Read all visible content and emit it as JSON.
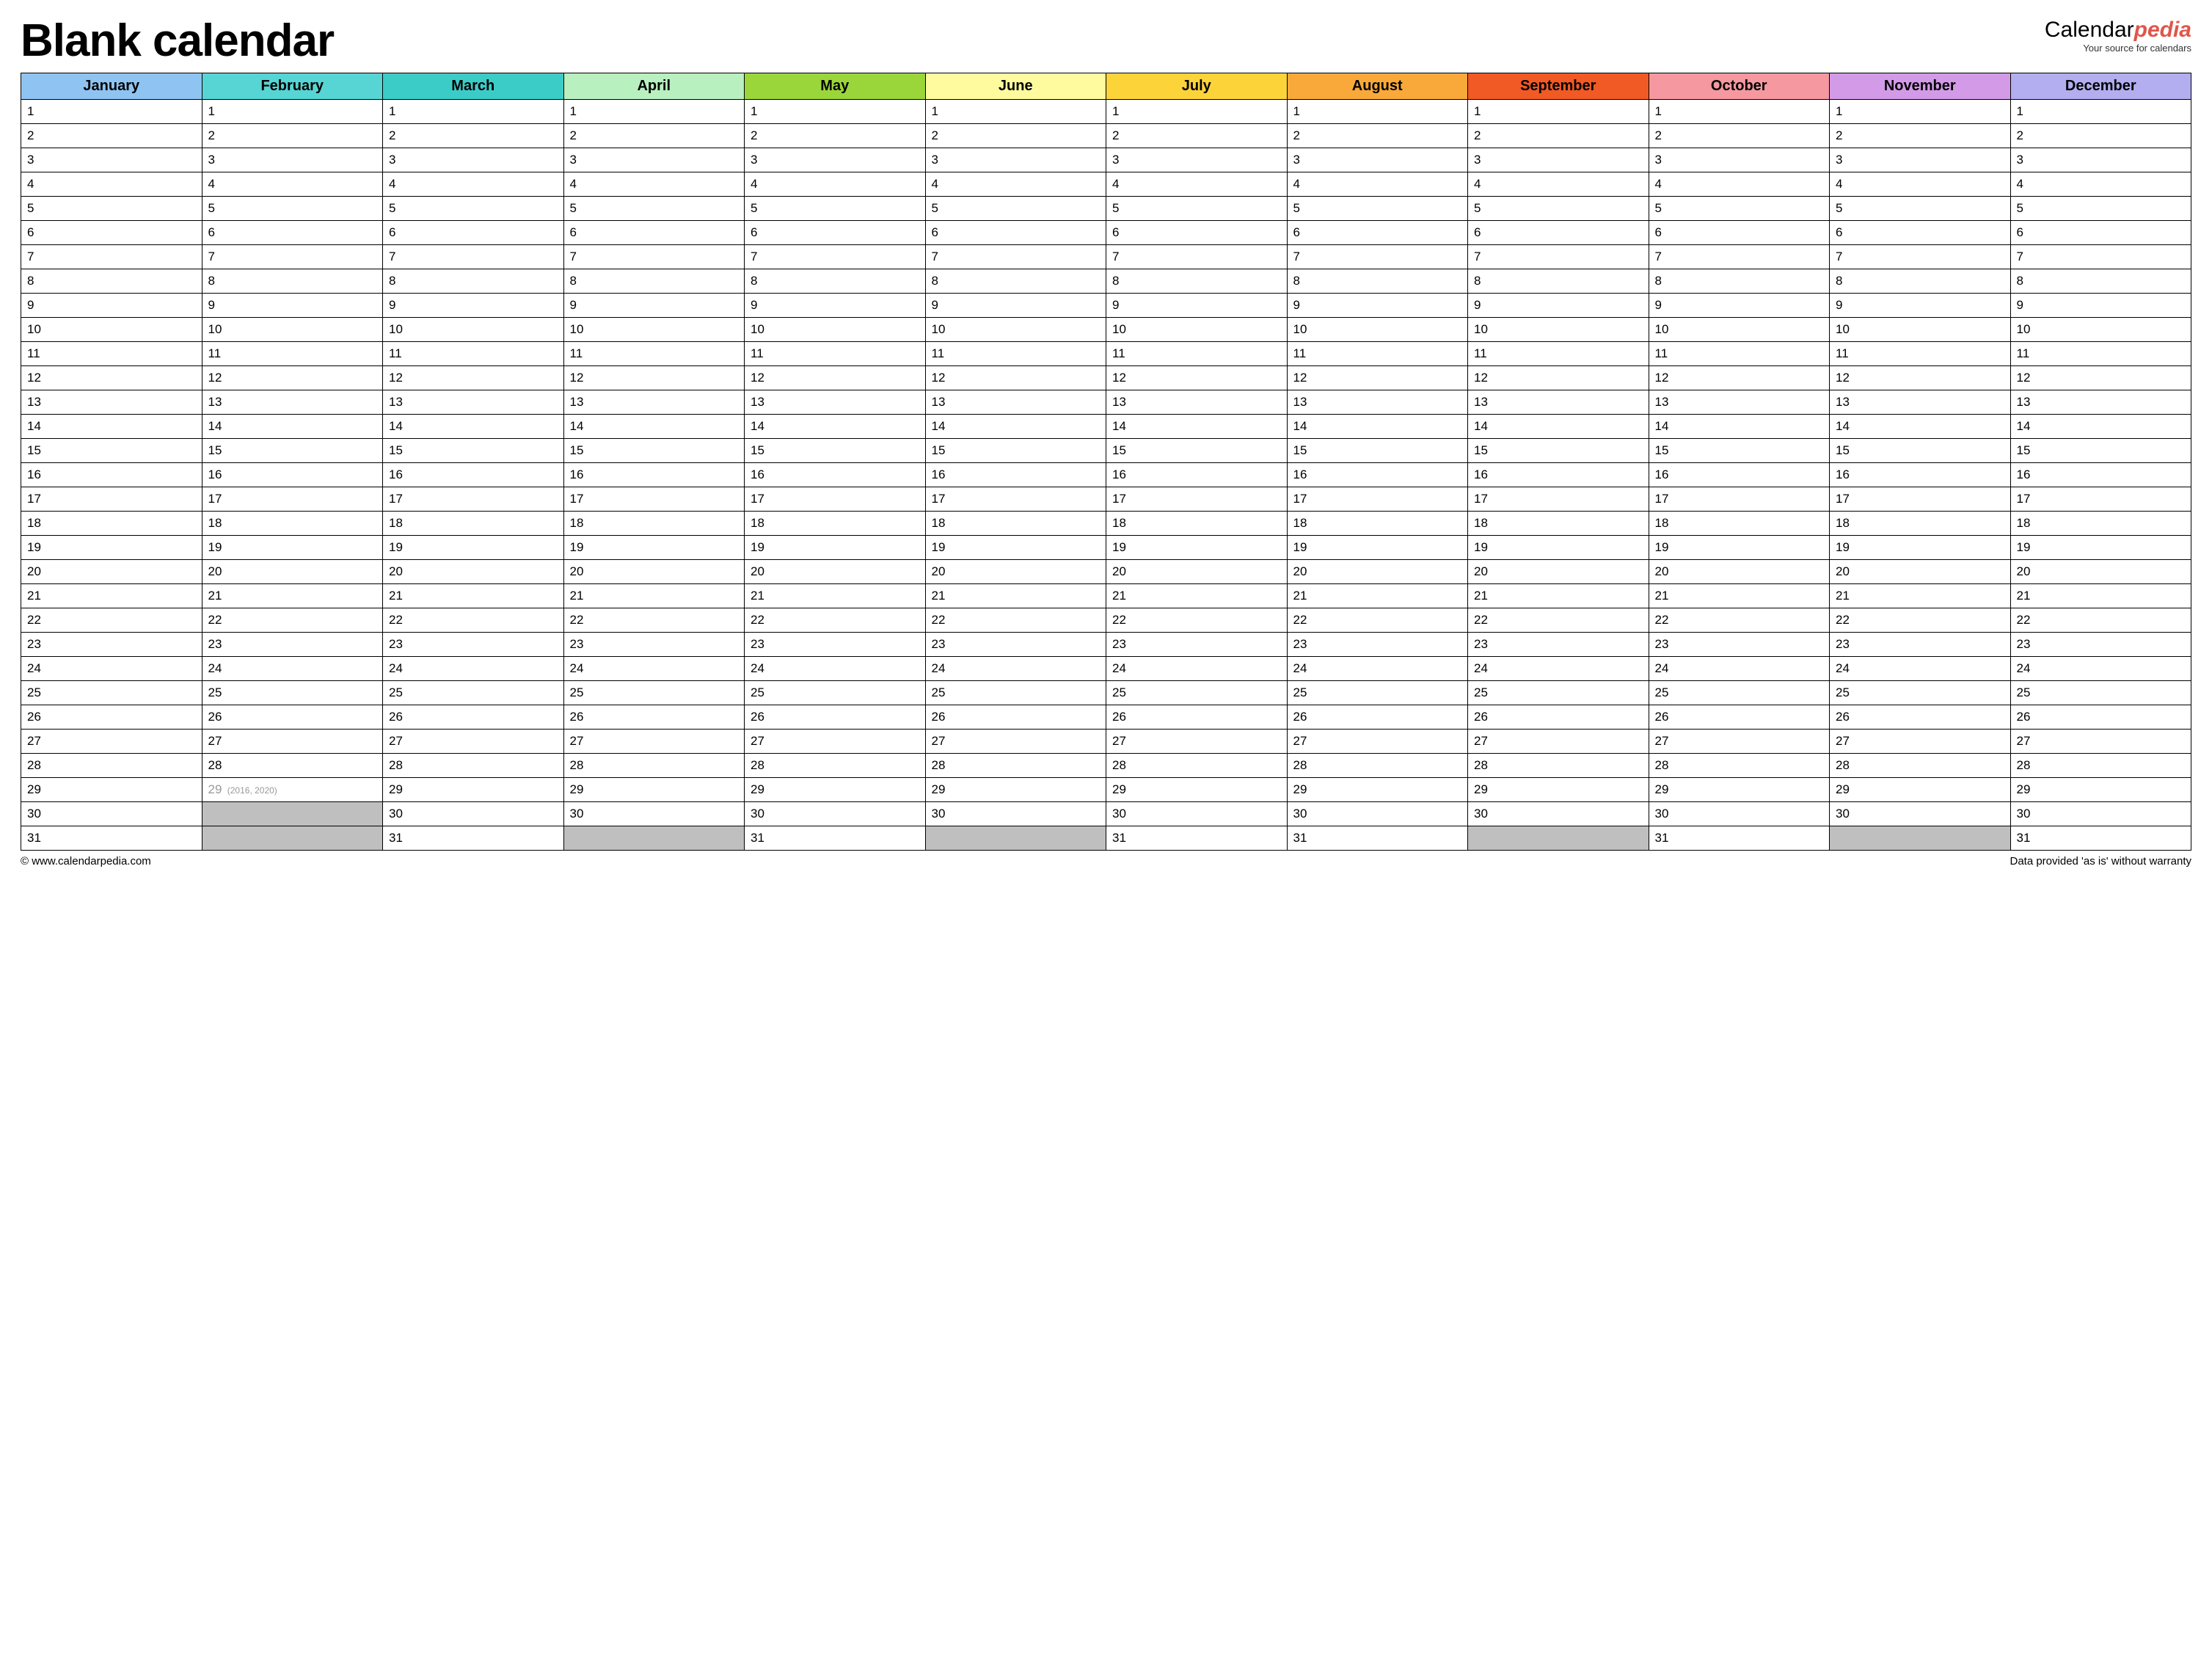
{
  "header": {
    "title": "Blank calendar",
    "brand_prefix": "Calendar",
    "brand_suffix": "pedia",
    "tagline": "Your source for calendars"
  },
  "months": [
    {
      "name": "January",
      "color": "#8fc4f2",
      "days": 31
    },
    {
      "name": "February",
      "color": "#56d5d4",
      "days": 28,
      "leap_day": 29,
      "leap_note": "(2016, 2020)"
    },
    {
      "name": "March",
      "color": "#3cccc8",
      "days": 31
    },
    {
      "name": "April",
      "color": "#b8f0bf",
      "days": 30
    },
    {
      "name": "May",
      "color": "#9ad63a",
      "days": 31
    },
    {
      "name": "June",
      "color": "#fdfb9e",
      "days": 30
    },
    {
      "name": "July",
      "color": "#fdd33a",
      "days": 31
    },
    {
      "name": "August",
      "color": "#f9a93a",
      "days": 31
    },
    {
      "name": "September",
      "color": "#f15a24",
      "days": 30
    },
    {
      "name": "October",
      "color": "#f598a0",
      "days": 31
    },
    {
      "name": "November",
      "color": "#d39ae8",
      "days": 30
    },
    {
      "name": "December",
      "color": "#b2aef0",
      "days": 31
    }
  ],
  "max_rows": 31,
  "footer": {
    "copyright": "© www.calendarpedia.com",
    "disclaimer": "Data provided 'as is' without warranty"
  }
}
